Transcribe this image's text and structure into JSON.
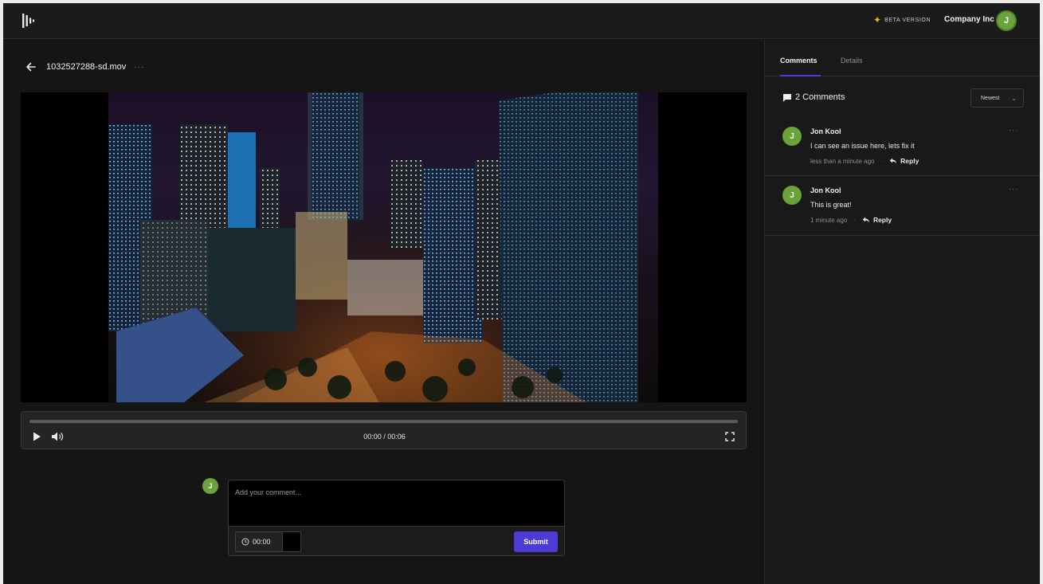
{
  "topbar": {
    "beta_label": "BETA VERSION",
    "company_name": "Company Inc",
    "user_initial": "J"
  },
  "file": {
    "name": "1032527288-sd.mov",
    "more": "···"
  },
  "player": {
    "current_time": "00:00",
    "duration": "00:06",
    "timecode": "00:00 / 00:06",
    "progress_fraction": 0
  },
  "composer": {
    "user_initial": "J",
    "placeholder": "Add your comment...",
    "timestamp": "00:00",
    "submit_label": "Submit"
  },
  "panel": {
    "tabs": [
      {
        "label": "Comments",
        "active": true
      },
      {
        "label": "Details",
        "active": false
      }
    ],
    "comment_count_label": "2 Comments",
    "sort_label": "Newest",
    "comments": [
      {
        "initial": "J",
        "author": "Jon Kool",
        "text": "I can see an issue here, lets fix it",
        "time": "less than a minute ago",
        "reply_label": "Reply",
        "more": "···"
      },
      {
        "initial": "J",
        "author": "Jon Kool",
        "text": "This is great!",
        "time": "1 minute ago",
        "reply_label": "Reply",
        "more": "···"
      }
    ]
  },
  "colors": {
    "accent": "#4c3bd6",
    "avatar": "#6aa33a",
    "beta_star": "#f3b11a",
    "background": "#151515"
  },
  "icons": {
    "logo": "app-logo-icon",
    "back": "arrow-left-icon",
    "play": "play-icon",
    "volume": "volume-icon",
    "fullscreen": "fullscreen-icon",
    "clock": "clock-icon",
    "chat": "chat-bubble-icon",
    "reply": "reply-arrow-icon",
    "sparkle": "sparkle-icon"
  }
}
